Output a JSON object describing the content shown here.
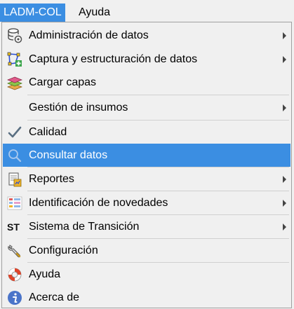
{
  "menubar": {
    "items": [
      {
        "label": "LADM-COL"
      },
      {
        "label": "Ayuda"
      }
    ]
  },
  "menu": {
    "items": [
      {
        "label": "Administración de datos",
        "icon": "database-settings-icon",
        "submenu": true
      },
      {
        "label": "Captura y estructuración de datos",
        "icon": "polygon-edit-icon",
        "submenu": true
      },
      {
        "label": "Cargar capas",
        "icon": "layers-icon",
        "submenu": false
      },
      {
        "label": "Gestión de insumos",
        "icon": "",
        "submenu": true
      },
      {
        "label": "Calidad",
        "icon": "checkmark-icon",
        "submenu": false
      },
      {
        "label": "Consultar datos",
        "icon": "search-icon",
        "submenu": false,
        "highlighted": true
      },
      {
        "label": "Reportes",
        "icon": "report-icon",
        "submenu": true
      },
      {
        "label": "Identificación de novedades",
        "icon": "novelties-icon",
        "submenu": true
      },
      {
        "label": "Sistema de Transición",
        "icon": "st-icon",
        "icon_text": "ST",
        "submenu": true
      },
      {
        "label": "Configuración",
        "icon": "wrench-icon",
        "submenu": false
      },
      {
        "label": "Ayuda",
        "icon": "lifebuoy-icon",
        "submenu": false
      },
      {
        "label": "Acerca de",
        "icon": "info-icon",
        "submenu": false
      }
    ]
  },
  "colors": {
    "highlight": "#3b8ee2",
    "menu_bg": "#f0f0f0"
  }
}
